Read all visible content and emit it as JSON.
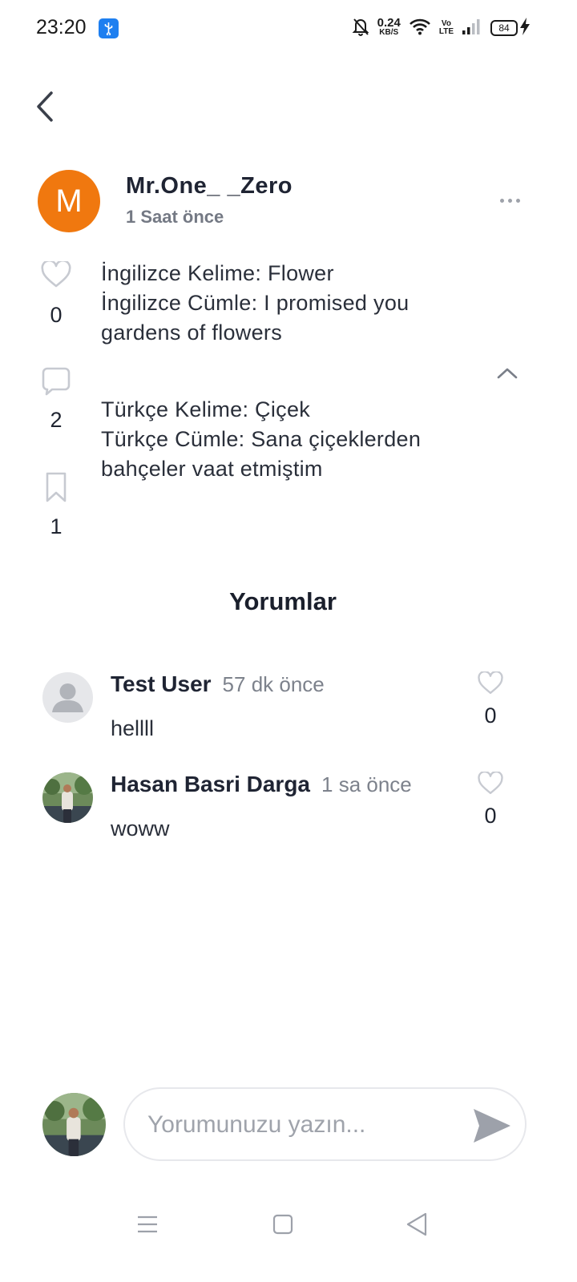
{
  "status_bar": {
    "time": "23:20",
    "net_speed_value": "0.24",
    "net_speed_unit": "KB/S",
    "volte_top": "Vo",
    "volte_bottom": "LTE",
    "battery": "84"
  },
  "post": {
    "avatar_letter": "M",
    "author": "Mr.One_ _Zero",
    "time": "1 Saat önce",
    "like_count": "0",
    "comment_count": "2",
    "bookmark_count": "1",
    "lines_en": [
      "İngilizce Kelime: Flower",
      "İngilizce Cümle: I promised you",
      "gardens of flowers"
    ],
    "lines_tr": [
      "Türkçe Kelime: Çiçek",
      "Türkçe Cümle: Sana çiçeklerden",
      "bahçeler vaat etmiştim"
    ]
  },
  "comments_section": {
    "title": "Yorumlar",
    "items": [
      {
        "user": "Test User",
        "time": "57 dk önce",
        "text": "hellll",
        "likes": "0"
      },
      {
        "user": "Hasan Basri Darga",
        "time": "1 sa önce",
        "text": "woww",
        "likes": "0"
      }
    ]
  },
  "compose": {
    "placeholder": "Yorumunuzu yazın..."
  },
  "colors": {
    "accent_orange": "#f0780f",
    "usb_blue": "#1e7ff0",
    "send_gray": "#9da1aa"
  }
}
